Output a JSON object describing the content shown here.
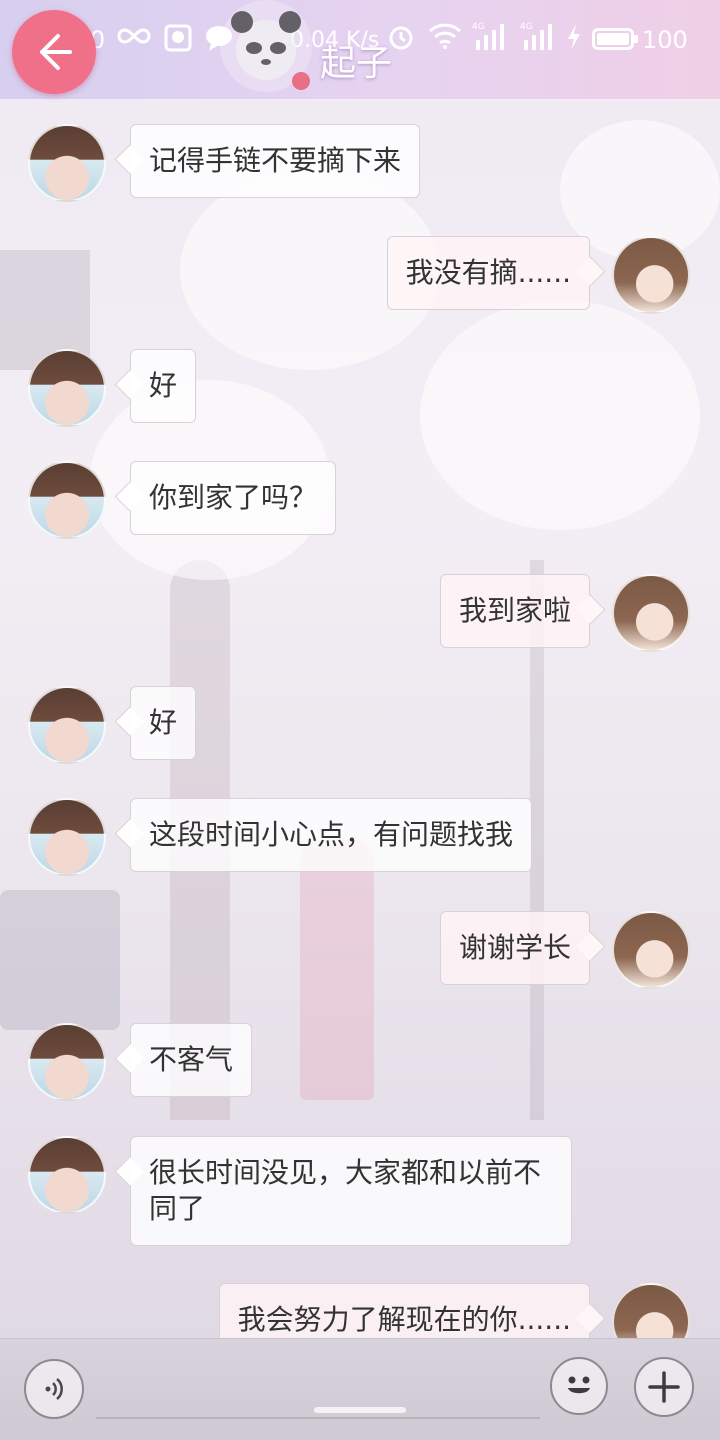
{
  "status_bar": {
    "time": "06:10",
    "net_speed": "0.04 K/s",
    "battery": "100",
    "signal_1": "4G",
    "signal_2": "4G"
  },
  "header": {
    "title": "起子",
    "back_icon": "back-arrow-icon"
  },
  "messages": [
    {
      "side": "left",
      "text": "记得手链不要摘下来"
    },
    {
      "side": "right",
      "text": "我没有摘......"
    },
    {
      "side": "left",
      "text": "好"
    },
    {
      "side": "left",
      "text": "你到家了吗？"
    },
    {
      "side": "right",
      "text": "我到家啦"
    },
    {
      "side": "left",
      "text": "好"
    },
    {
      "side": "left",
      "text": "这段时间小心点，有问题找我"
    },
    {
      "side": "right",
      "text": "谢谢学长"
    },
    {
      "side": "left",
      "text": "不客气"
    },
    {
      "side": "left",
      "text": "很长时间没见，大家都和以前不同了"
    },
    {
      "side": "right",
      "text": "我会努力了解现在的你......"
    }
  ],
  "bottom_bar": {
    "voice_icon": "voice-icon",
    "emoji_icon": "emoji-icon",
    "plus_icon": "plus-icon"
  },
  "colors": {
    "accent": "#f0708a",
    "header_gradient_start": "#d7cff0",
    "header_gradient_end": "#efcfe6",
    "bubble_border": "#d8d2d8",
    "text": "#333333"
  }
}
